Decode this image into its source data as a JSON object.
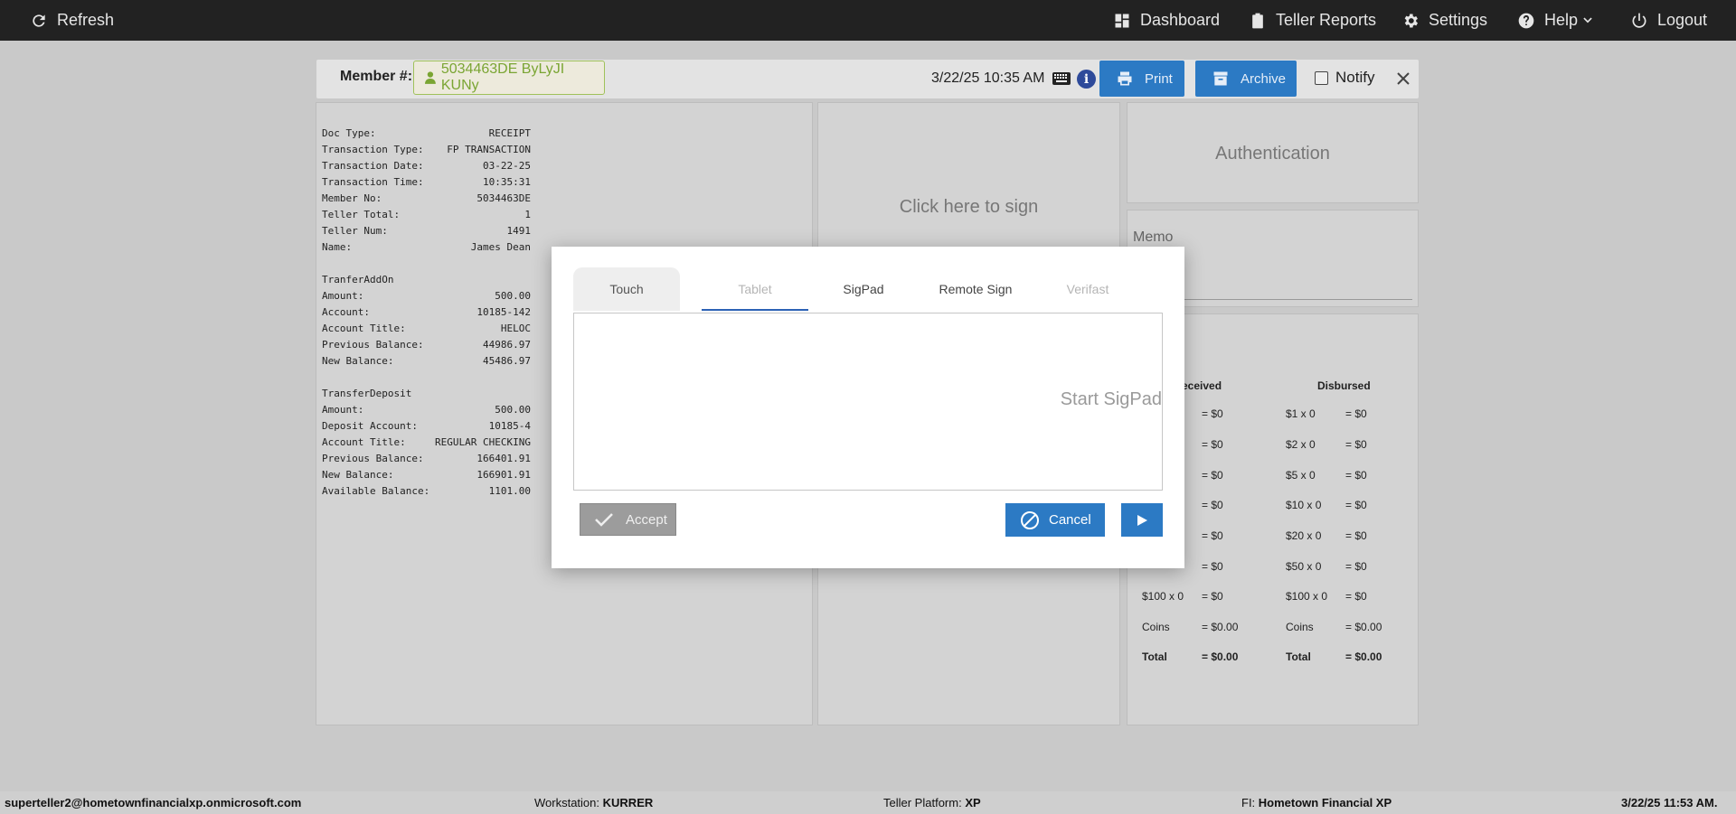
{
  "topbar": {
    "refresh": "Refresh",
    "dashboard": "Dashboard",
    "teller_reports": "Teller Reports",
    "settings": "Settings",
    "help": "Help",
    "logout": "Logout"
  },
  "member_bar": {
    "label": "Member #:",
    "member_value": "5034463DE ByLyJI KUNy",
    "datetime": "3/22/25 10:35 AM",
    "print": "Print",
    "archive": "Archive",
    "notify": "Notify"
  },
  "receipt": {
    "rows": [
      {
        "k": "Doc Type:",
        "v": "RECEIPT"
      },
      {
        "k": "Transaction Type:",
        "v": "FP TRANSACTION"
      },
      {
        "k": "Transaction Date:",
        "v": "03-22-25"
      },
      {
        "k": "Transaction Time:",
        "v": "10:35:31"
      },
      {
        "k": "Member No:",
        "v": "5034463DE"
      },
      {
        "k": "Teller Total:",
        "v": "1"
      },
      {
        "k": "Teller Num:",
        "v": "1491"
      },
      {
        "k": "Name:",
        "v": "James Dean"
      },
      {
        "k": "TranferAddOn",
        "v": ""
      },
      {
        "k": "Amount:",
        "v": "500.00"
      },
      {
        "k": "Account:",
        "v": "10185-142"
      },
      {
        "k": "Account Title:",
        "v": "HELOC"
      },
      {
        "k": "Previous Balance:",
        "v": "44986.97"
      },
      {
        "k": "New Balance:",
        "v": "45486.97"
      },
      {
        "k": "TransferDeposit",
        "v": ""
      },
      {
        "k": "Amount:",
        "v": "500.00"
      },
      {
        "k": "Deposit Account:",
        "v": "10185-4"
      },
      {
        "k": "Account Title:",
        "v": "REGULAR CHECKING"
      },
      {
        "k": "Previous Balance:",
        "v": "166401.91"
      },
      {
        "k": "New Balance:",
        "v": "166901.91"
      },
      {
        "k": "Available Balance:",
        "v": "1101.00"
      }
    ]
  },
  "sign_panel": {
    "text": "Click here to sign"
  },
  "auth_panel": {
    "text": "Authentication"
  },
  "memo_panel": {
    "label": "Memo"
  },
  "cash": {
    "received_header": "eceived",
    "disbursed_header": "Disbursed",
    "received": [
      {
        "d": "",
        "v": "= $0"
      },
      {
        "d": "",
        "v": "= $0"
      },
      {
        "d": "",
        "v": "= $0"
      },
      {
        "d": "",
        "v": "= $0"
      },
      {
        "d": "",
        "v": "= $0"
      },
      {
        "d": "",
        "v": "= $0"
      },
      {
        "d": "$100 x 0",
        "v": "= $0"
      },
      {
        "d": "Coins",
        "v": "= $0.00"
      },
      {
        "d": "Total",
        "v": "= $0.00"
      }
    ],
    "disbursed": [
      {
        "d": "$1 x 0",
        "v": "= $0"
      },
      {
        "d": "$2 x 0",
        "v": "= $0"
      },
      {
        "d": "$5 x 0",
        "v": "= $0"
      },
      {
        "d": "$10 x 0",
        "v": "= $0"
      },
      {
        "d": "$20 x 0",
        "v": "= $0"
      },
      {
        "d": "$50 x 0",
        "v": "= $0"
      },
      {
        "d": "$100 x 0",
        "v": "= $0"
      },
      {
        "d": "Coins",
        "v": "= $0.00"
      },
      {
        "d": "Total",
        "v": "= $0.00"
      }
    ]
  },
  "modal": {
    "tabs": [
      "Touch",
      "Tablet",
      "SigPad",
      "Remote Sign",
      "Verifast"
    ],
    "active_tab": "Tablet",
    "sig_prompt": "Start SigPad",
    "accept": "Accept",
    "cancel": "Cancel"
  },
  "statusbar": {
    "user": "superteller2@hometownfinancialxp.onmicrosoft.com",
    "workstation_label": "Workstation:",
    "workstation": "KURRER",
    "platform_label": "Teller Platform:",
    "platform": "XP",
    "fi_label": "FI:",
    "fi": "Hometown Financial XP",
    "datetime": "3/22/25 11:53 AM."
  },
  "colors": {
    "topbar": "#222222",
    "accent_blue": "#2c7ac4",
    "member_green": "#7aa533"
  }
}
